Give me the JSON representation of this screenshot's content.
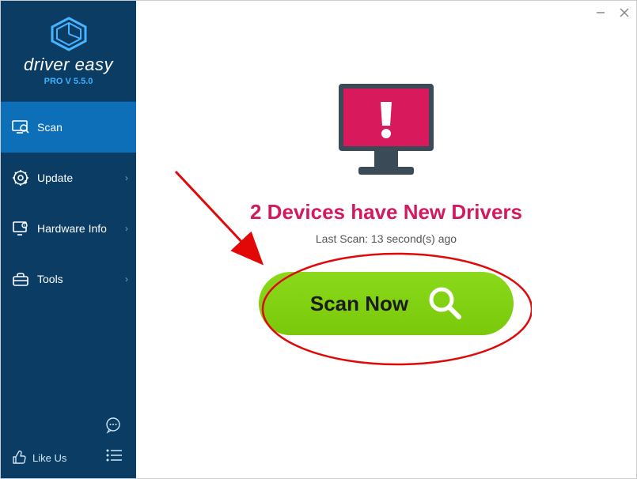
{
  "brand": {
    "name": "driver easy",
    "version": "PRO V 5.5.0"
  },
  "nav": {
    "scan": "Scan",
    "update": "Update",
    "hardware": "Hardware Info",
    "tools": "Tools"
  },
  "footer": {
    "like_us": "Like Us"
  },
  "main": {
    "headline": "2 Devices have New Drivers",
    "last_scan": "Last Scan: 13 second(s) ago",
    "scan_button": "Scan Now"
  },
  "colors": {
    "sidebar_bg": "#0a3c64",
    "sidebar_active": "#0d6fb8",
    "accent_pink": "#d31a61",
    "scan_green": "#7ac80a"
  }
}
